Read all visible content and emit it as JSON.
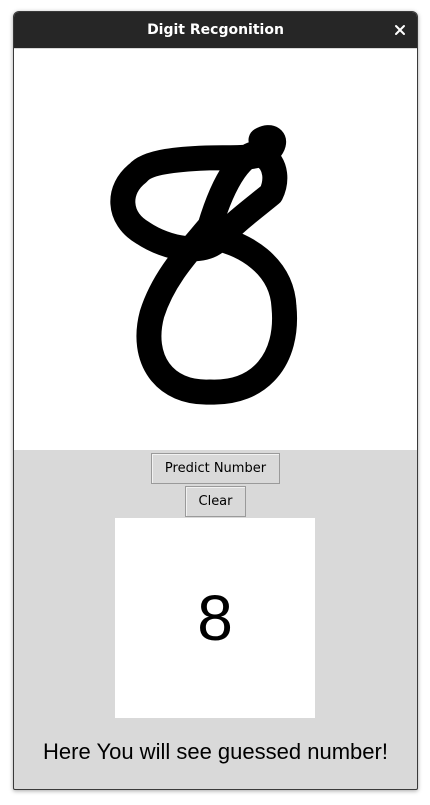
{
  "window": {
    "title": "Digit Recgonition",
    "close_icon": "close-icon"
  },
  "canvas": {
    "drawn_digit": "8",
    "stroke_color": "#000000",
    "background_color": "#ffffff"
  },
  "controls": {
    "predict_label": "Predict Number",
    "clear_label": "Clear"
  },
  "result": {
    "digit": "8",
    "message": "Here You will see guessed number!"
  },
  "colors": {
    "titlebar": "#262626",
    "panel": "#d9d9d9"
  }
}
